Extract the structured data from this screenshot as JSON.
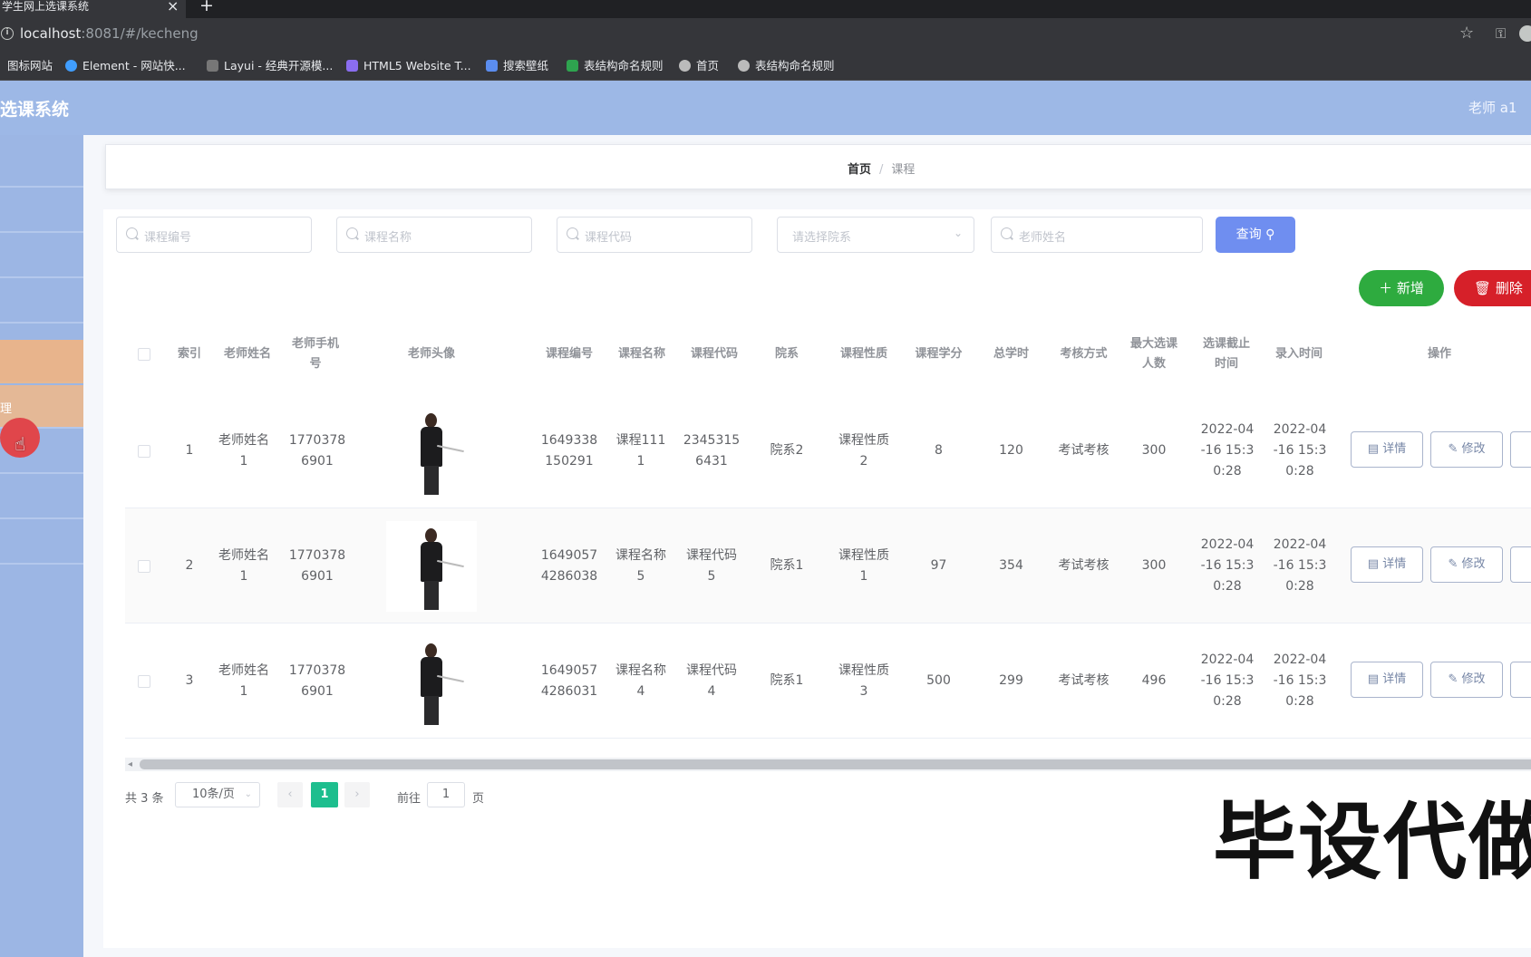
{
  "browser": {
    "tab_title": "学生网上选课系统",
    "url_host": "localhost",
    "url_rest": ":8081/#/kecheng",
    "bookmarks": [
      "图标网站",
      "Element - 网站快...",
      "Layui - 经典开源模...",
      "HTML5 Website T...",
      "搜索壁纸",
      "表结构命名规则",
      "首页",
      "表结构命名规则"
    ]
  },
  "header": {
    "title": "选课系统",
    "user": "老师 a1"
  },
  "sidebar": {
    "partial_label": "理"
  },
  "breadcrumb": {
    "home": "首页",
    "separator": "/",
    "current": "课程"
  },
  "search": {
    "course_no": "课程编号",
    "course_name": "课程名称",
    "course_code": "课程代码",
    "department": "请选择院系",
    "teacher_name": "老师姓名",
    "query_button": "查询"
  },
  "actions": {
    "add": "新增",
    "delete": "删除"
  },
  "table": {
    "columns": [
      "索引",
      "老师姓名",
      "老师手机号",
      "老师头像",
      "课程编号",
      "课程名称",
      "课程代码",
      "院系",
      "课程性质",
      "课程学分",
      "总学时",
      "考核方式",
      "最大选课人数",
      "选课截止时间",
      "录入时间",
      "操作"
    ],
    "rows": [
      {
        "index": "1",
        "teacher_name": "老师姓名1",
        "teacher_phone": "17703786901",
        "course_no": "1649338150291",
        "course_name": "课程1111",
        "course_code": "23453156431",
        "department": "院系2",
        "nature": "课程性质2",
        "credit": "8",
        "hours": "120",
        "assessment": "考试考核",
        "max_students": "300",
        "deadline": "2022-04-16 15:30:28",
        "created": "2022-04-16 15:30:28"
      },
      {
        "index": "2",
        "teacher_name": "老师姓名1",
        "teacher_phone": "17703786901",
        "course_no": "16490574286038",
        "course_name": "课程名称5",
        "course_code": "课程代码5",
        "department": "院系1",
        "nature": "课程性质1",
        "credit": "97",
        "hours": "354",
        "assessment": "考试考核",
        "max_students": "300",
        "deadline": "2022-04-16 15:30:28",
        "created": "2022-04-16 15:30:28"
      },
      {
        "index": "3",
        "teacher_name": "老师姓名1",
        "teacher_phone": "17703786901",
        "course_no": "16490574286031",
        "course_name": "课程名称4",
        "course_code": "课程代码4",
        "department": "院系1",
        "nature": "课程性质3",
        "credit": "500",
        "hours": "299",
        "assessment": "考试考核",
        "max_students": "496",
        "deadline": "2022-04-16 15:30:28",
        "created": "2022-04-16 15:30:28"
      }
    ],
    "row_buttons": {
      "detail": "详情",
      "edit": "修改"
    }
  },
  "pagination": {
    "total": "共 3 条",
    "page_size": "10条/页",
    "current_page": "1",
    "goto_label": "前往",
    "goto_value": "1",
    "page_suffix": "页"
  },
  "watermark": "毕设代做",
  "colors": {
    "header_bg": "#9db8e6",
    "sidebar_active": "#e8b48c",
    "query_button": "#6f8ef0",
    "add_button": "#2eab3f",
    "delete_button": "#d62029",
    "pager_active": "#1dbe8e"
  }
}
